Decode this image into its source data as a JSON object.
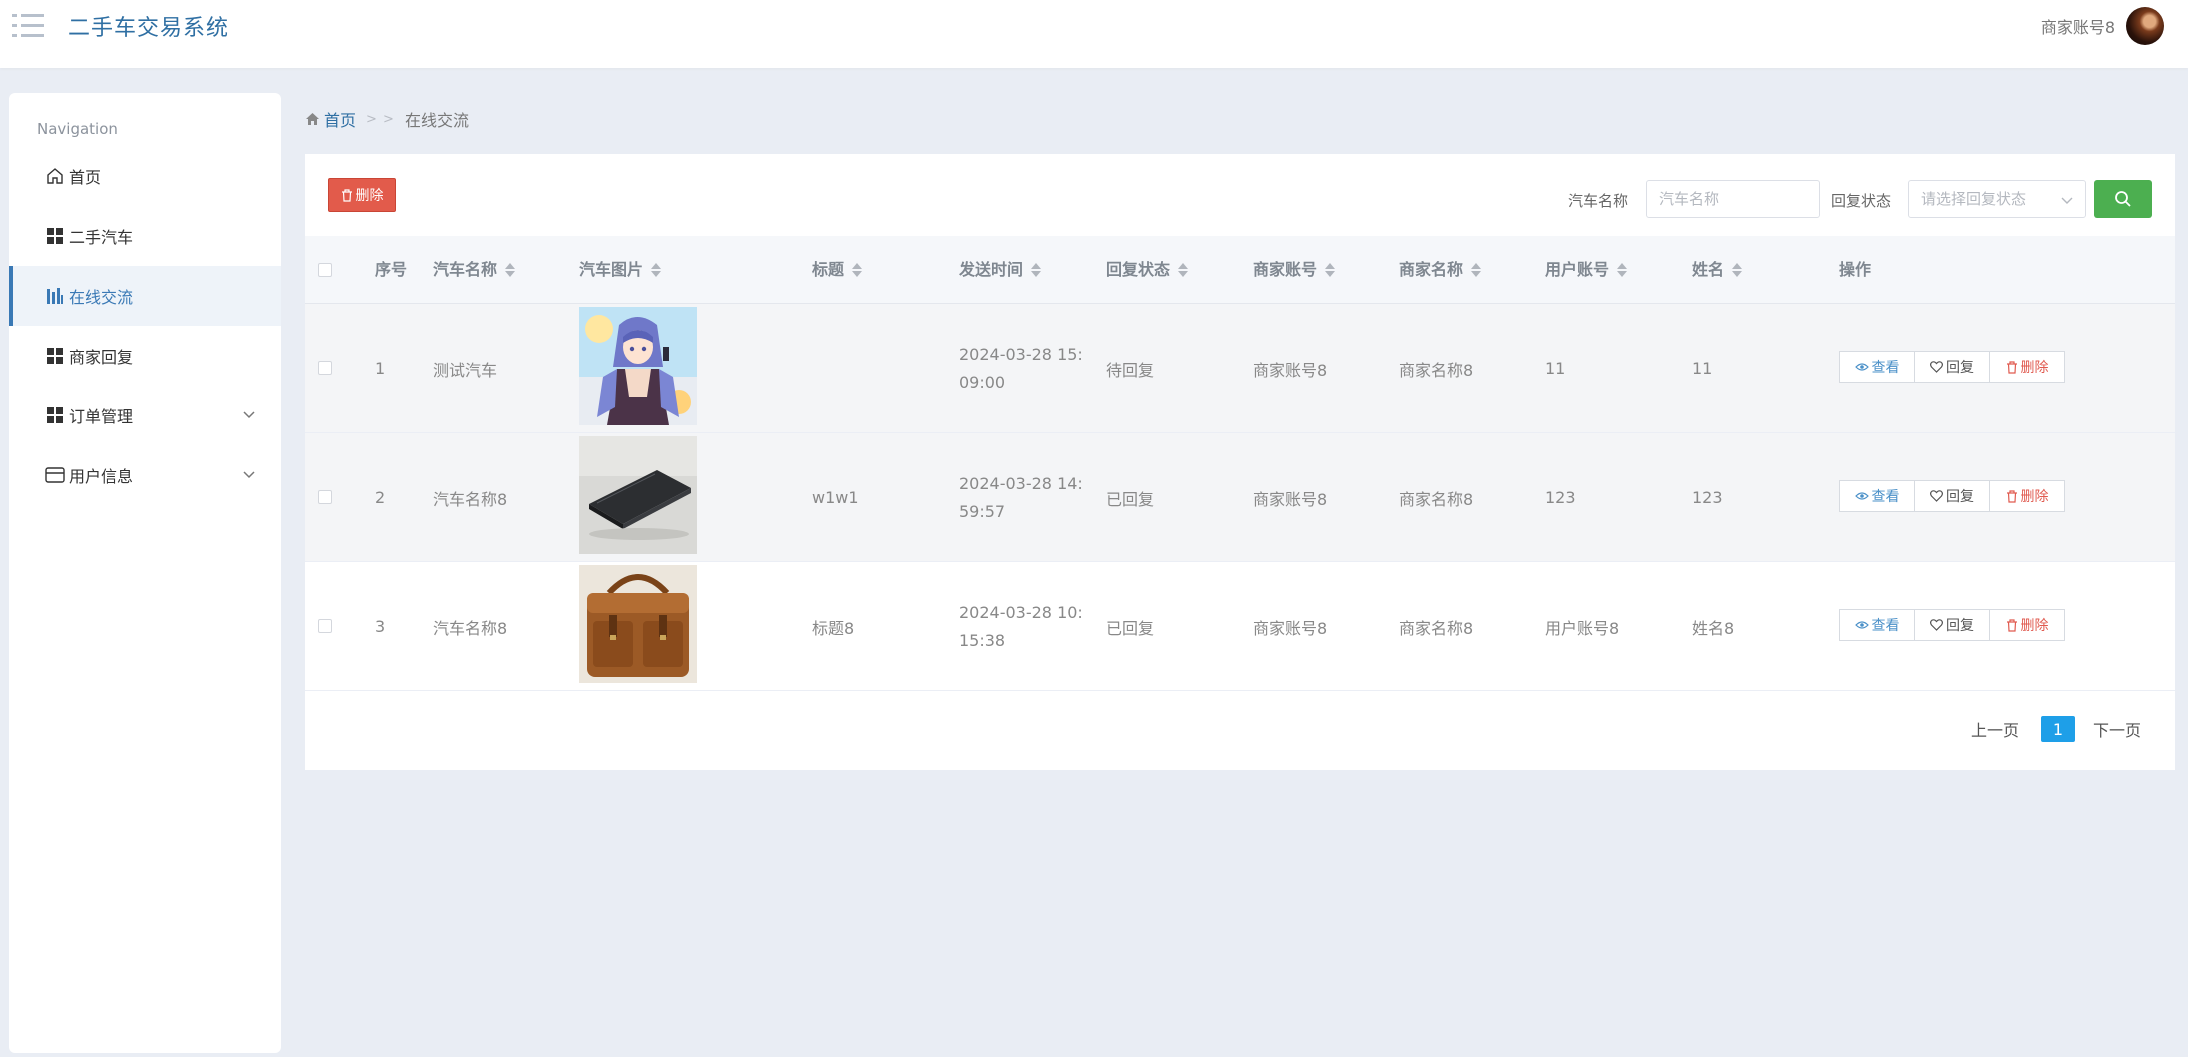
{
  "header": {
    "menu_icon": "list-menu-icon",
    "app_title": "二手车交易系统",
    "user_name": "商家账号8"
  },
  "sidebar": {
    "heading": "Navigation",
    "items": [
      {
        "label": "首页",
        "icon": "home-icon"
      },
      {
        "label": "二手汽车",
        "icon": "grid-icon"
      },
      {
        "label": "在线交流",
        "icon": "chart-bar-icon",
        "active": true
      },
      {
        "label": "商家回复",
        "icon": "grid-icon"
      },
      {
        "label": "订单管理",
        "icon": "grid-icon",
        "expandable": true
      },
      {
        "label": "用户信息",
        "icon": "card-icon",
        "expandable": true
      }
    ]
  },
  "breadcrumb": {
    "home": "首页",
    "separator": "> >",
    "current": "在线交流"
  },
  "toolbar": {
    "delete_label": "删除",
    "car_name_label": "汽车名称",
    "car_name_placeholder": "汽车名称",
    "car_name_value": "",
    "reply_status_label": "回复状态",
    "reply_status_placeholder": "请选择回复状态",
    "search_icon": "search-icon"
  },
  "table": {
    "columns": [
      "序号",
      "汽车名称",
      "汽车图片",
      "标题",
      "发送时间",
      "回复状态",
      "商家账号",
      "商家名称",
      "用户账号",
      "姓名",
      "操作"
    ],
    "rows": [
      {
        "index": "1",
        "car_name": "测试汽车",
        "image": "anime-character-photo",
        "title": "",
        "time_line1": "2024-03-28 15:",
        "time_line2": "09:00",
        "status": "待回复",
        "merchant_account": "商家账号8",
        "merchant_name": "商家名称8",
        "user_account": "11",
        "name": "11"
      },
      {
        "index": "2",
        "car_name": "汽车名称8",
        "image": "laptop-photo",
        "title": "w1w1",
        "time_line1": "2024-03-28 14:",
        "time_line2": "59:57",
        "status": "已回复",
        "merchant_account": "商家账号8",
        "merchant_name": "商家名称8",
        "user_account": "123",
        "name": "123"
      },
      {
        "index": "3",
        "car_name": "汽车名称8",
        "image": "leather-bag-photo",
        "title": "标题8",
        "time_line1": "2024-03-28 10:",
        "time_line2": "15:38",
        "status": "已回复",
        "merchant_account": "商家账号8",
        "merchant_name": "商家名称8",
        "user_account": "用户账号8",
        "name": "姓名8"
      }
    ],
    "actions": {
      "view": "查看",
      "reply": "回复",
      "delete": "删除"
    }
  },
  "pagination": {
    "prev": "上一页",
    "current": "1",
    "next": "下一页"
  },
  "colors": {
    "accent": "#2f6fa3",
    "delete_button": "#e25b4b",
    "search_button": "#4caf50",
    "page_active": "#1e9fe8"
  }
}
